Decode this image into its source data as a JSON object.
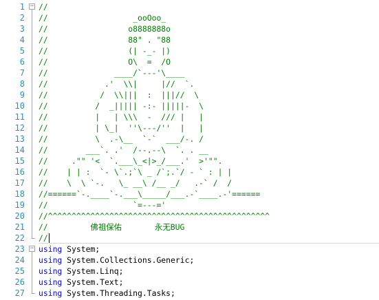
{
  "editor": {
    "language_colors": {
      "comment": "#008000",
      "keyword": "#0000ff",
      "line_number": "#2b91af"
    },
    "fold_icons": [
      "minus-icon",
      "minus-icon"
    ],
    "lines": [
      {
        "n": "1",
        "segments": [
          {
            "t": "//",
            "c": "comment"
          }
        ]
      },
      {
        "n": "2",
        "segments": [
          {
            "t": "//                  _ooOoo_",
            "c": "comment"
          }
        ]
      },
      {
        "n": "3",
        "segments": [
          {
            "t": "//                 o8888888o",
            "c": "comment"
          }
        ]
      },
      {
        "n": "4",
        "segments": [
          {
            "t": "//                 88\" . \"88",
            "c": "comment"
          }
        ]
      },
      {
        "n": "5",
        "segments": [
          {
            "t": "//                 (| -_- |)",
            "c": "comment"
          }
        ]
      },
      {
        "n": "6",
        "segments": [
          {
            "t": "//                 O\\  =  /O",
            "c": "comment"
          }
        ]
      },
      {
        "n": "7",
        "segments": [
          {
            "t": "//              ____/`---'\\____",
            "c": "comment"
          }
        ]
      },
      {
        "n": "8",
        "segments": [
          {
            "t": "//            .'  \\\\|     |//  `.",
            "c": "comment"
          }
        ]
      },
      {
        "n": "9",
        "segments": [
          {
            "t": "//           /  \\\\|||  :  |||//  \\",
            "c": "comment"
          }
        ]
      },
      {
        "n": "10",
        "segments": [
          {
            "t": "//          /  _||||| -:- |||||-  \\",
            "c": "comment"
          }
        ]
      },
      {
        "n": "11",
        "segments": [
          {
            "t": "//          |   | \\\\\\  -  /// |   |",
            "c": "comment"
          }
        ]
      },
      {
        "n": "12",
        "segments": [
          {
            "t": "//          | \\_|  ''\\---/''  |   |",
            "c": "comment"
          }
        ]
      },
      {
        "n": "13",
        "segments": [
          {
            "t": "//          \\  .-\\__  `-`  ___/-. /",
            "c": "comment"
          }
        ]
      },
      {
        "n": "14",
        "segments": [
          {
            "t": "//        ___`. .'  /--.--\\  `. . __",
            "c": "comment"
          }
        ]
      },
      {
        "n": "15",
        "segments": [
          {
            "t": "//     .\"\" '<  `.___\\_<|>_/___.'  >'\"\".",
            "c": "comment"
          }
        ]
      },
      {
        "n": "16",
        "segments": [
          {
            "t": "//    | | :  `- \\`.;`\\ _ /`;.`/ - ` : | |",
            "c": "comment"
          }
        ]
      },
      {
        "n": "17",
        "segments": [
          {
            "t": "//    \\  \\ `-.   \\_ __\\ /__ _/   .-` /  /",
            "c": "comment"
          }
        ]
      },
      {
        "n": "18",
        "segments": [
          {
            "t": "//======`-.____`-.___\\_____/___.-`____.-'======",
            "c": "comment"
          }
        ]
      },
      {
        "n": "19",
        "segments": [
          {
            "t": "//                  `=---='",
            "c": "comment"
          }
        ]
      },
      {
        "n": "20",
        "segments": [
          {
            "t": "//^^^^^^^^^^^^^^^^^^^^^^^^^^^^^^^^^^^^^^^^^^^^^^^",
            "c": "comment"
          }
        ]
      },
      {
        "n": "21",
        "segments": [
          {
            "t": "//         佛祖保佑       永无BUG",
            "c": "comment"
          }
        ]
      },
      {
        "n": "22",
        "segments": [
          {
            "t": "//",
            "c": "comment"
          }
        ]
      },
      {
        "n": "23",
        "segments": [
          {
            "t": "using",
            "c": "kw"
          },
          {
            "t": " System;",
            "c": "plain"
          }
        ]
      },
      {
        "n": "24",
        "segments": [
          {
            "t": "using",
            "c": "kw"
          },
          {
            "t": " System.Collections.Generic;",
            "c": "plain"
          }
        ]
      },
      {
        "n": "25",
        "segments": [
          {
            "t": "using",
            "c": "kw"
          },
          {
            "t": " System.Linq;",
            "c": "plain"
          }
        ]
      },
      {
        "n": "26",
        "segments": [
          {
            "t": "using",
            "c": "kw"
          },
          {
            "t": " System.Text;",
            "c": "plain"
          }
        ]
      },
      {
        "n": "27",
        "segments": [
          {
            "t": "using",
            "c": "kw"
          },
          {
            "t": " System.Threading.Tasks;",
            "c": "plain"
          }
        ]
      }
    ]
  }
}
